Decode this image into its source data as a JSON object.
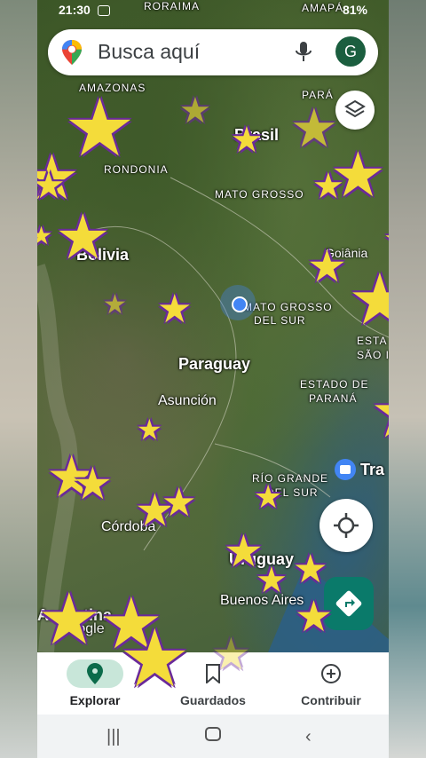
{
  "status_bar": {
    "time": "21:30",
    "battery": "81%"
  },
  "search": {
    "placeholder": "Busca aquí",
    "avatar_initial": "G"
  },
  "map": {
    "labels": [
      {
        "id": "roraima",
        "text": "RORAIMA"
      },
      {
        "id": "amapa",
        "text": "AMAPÁ"
      },
      {
        "id": "amazonas",
        "text": "AMAZONAS"
      },
      {
        "id": "para",
        "text": "PARÁ"
      },
      {
        "id": "brasil",
        "text": "Brasil"
      },
      {
        "id": "rondonia",
        "text": "RONDONIA"
      },
      {
        "id": "mato_grosso",
        "text": "MATO GROSSO"
      },
      {
        "id": "bolivia",
        "text": "Bolivia"
      },
      {
        "id": "goiania",
        "text": "Goiânia"
      },
      {
        "id": "mato_grosso_sur",
        "text": "MATO GROSSO"
      },
      {
        "id": "del_sur",
        "text": "DEL SUR"
      },
      {
        "id": "paraguay",
        "text": "Paraguay"
      },
      {
        "id": "estado",
        "text": "ESTA"
      },
      {
        "id": "sao",
        "text": "SÃO I"
      },
      {
        "id": "asuncion",
        "text": "Asunción"
      },
      {
        "id": "estado_de",
        "text": "ESTADO DE"
      },
      {
        "id": "parana",
        "text": "PARANÁ"
      },
      {
        "id": "rio_grande",
        "text": "RÍO GRANDE"
      },
      {
        "id": "rio_del_sur",
        "text": "DEL SUR"
      },
      {
        "id": "tra",
        "text": "Tra"
      },
      {
        "id": "cordoba",
        "text": "Córdoba"
      },
      {
        "id": "uruguay",
        "text": "Uruguay"
      },
      {
        "id": "buenos_aires",
        "text": "Buenos Aires"
      },
      {
        "id": "argentina",
        "text": "Argentina"
      },
      {
        "id": "google",
        "text": "Google"
      }
    ]
  },
  "nav": {
    "explore": "Explorar",
    "saved": "Guardados",
    "contribute": "Contribuir"
  },
  "colors": {
    "accent": "#1b5e3f",
    "pin_blue": "#4285f4",
    "star_fill": "#f4dc3a",
    "star_outline": "#6a2a9a"
  }
}
